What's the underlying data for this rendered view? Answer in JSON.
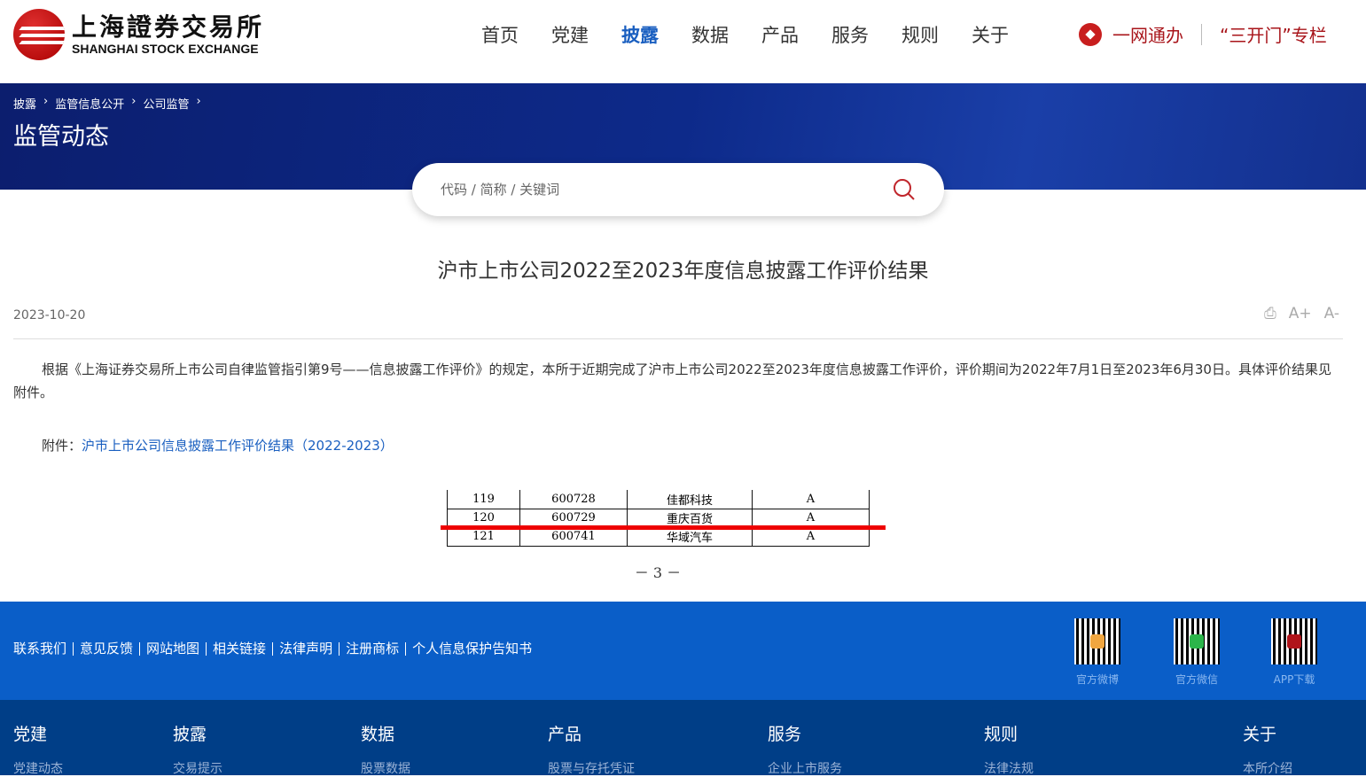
{
  "header": {
    "logo_cn": "上海證券交易所",
    "logo_en": "SHANGHAI STOCK EXCHANGE",
    "nav": [
      {
        "label": "首页"
      },
      {
        "label": "党建"
      },
      {
        "label": "披露",
        "active": true
      },
      {
        "label": "数据"
      },
      {
        "label": "产品"
      },
      {
        "label": "服务"
      },
      {
        "label": "规则"
      },
      {
        "label": "关于"
      }
    ],
    "one_net": "一网通办",
    "three_doors": "“三开门”专栏"
  },
  "banner": {
    "breadcrumb": [
      "披露",
      "监管信息公开",
      "公司监管"
    ],
    "title": "监管动态"
  },
  "search": {
    "placeholder": "代码 / 简称 / 关键词"
  },
  "article": {
    "title": "沪市上市公司2022至2023年度信息披露工作评价结果",
    "date": "2023-10-20",
    "tools": {
      "print": "⎙",
      "font_up": "A+",
      "font_down": "A-"
    },
    "body": "根据《上海证券交易所上市公司自律监管指引第9号——信息披露工作评价》的规定，本所于近期完成了沪市上市公司2022至2023年度信息披露工作评价，评价期间为2022年7月1日至2023年6月30日。具体评价结果见附件。",
    "attachment_label": "附件：",
    "attachment_link": "沪市上市公司信息披露工作评价结果（2022-2023）",
    "table_rows": [
      [
        "119",
        "600728",
        "佳都科技",
        "A"
      ],
      [
        "120",
        "600729",
        "重庆百货",
        "A"
      ],
      [
        "121",
        "600741",
        "华域汽车",
        "A"
      ]
    ],
    "page_number": "－ 3 －"
  },
  "footer": {
    "links": [
      "联系我们",
      "意见反馈",
      "网站地图",
      "相关链接",
      "法律声明",
      "注册商标",
      "个人信息保护告知书"
    ],
    "qr": [
      {
        "label": "官方微博",
        "color": "#f0a640"
      },
      {
        "label": "官方微信",
        "color": "#2bb54a"
      },
      {
        "label": "APP下载",
        "color": "#b0141a"
      }
    ],
    "columns": [
      {
        "title": "党建",
        "sub": "党建动态"
      },
      {
        "title": "披露",
        "sub": "交易提示"
      },
      {
        "title": "数据",
        "sub": "股票数据"
      },
      {
        "title": "产品",
        "sub": "股票与存托凭证"
      },
      {
        "title": "服务",
        "sub": "企业上市服务"
      },
      {
        "title": "规则",
        "sub": "法律法规"
      },
      {
        "title": "关于",
        "sub": "本所介绍"
      }
    ]
  },
  "colors": {
    "accent": "#1a5fc0",
    "brand_red": "#a8141a",
    "footer_blue": "#0a5ec8",
    "footer_dark": "#003e87"
  }
}
